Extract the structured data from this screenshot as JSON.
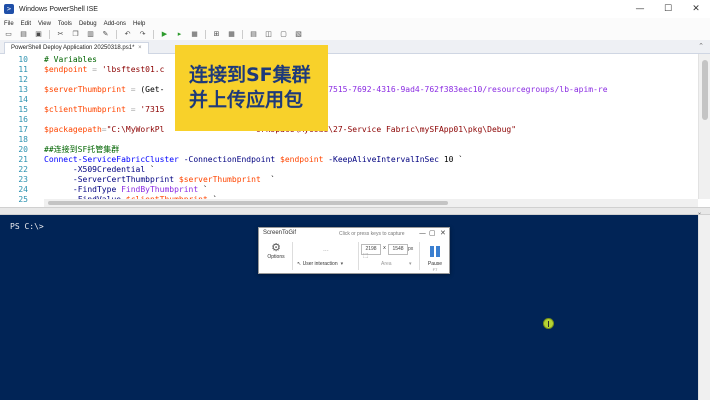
{
  "window": {
    "title": "Windows PowerShell ISE",
    "app_icon": "powershell-icon",
    "controls": [
      "—",
      "☐",
      "✕"
    ]
  },
  "menu": [
    "File",
    "Edit",
    "View",
    "Tools",
    "Debug",
    "Add-ons",
    "Help"
  ],
  "toolbar": {
    "icons": [
      "new-file-icon",
      "open-folder-icon",
      "save-icon",
      "cut-icon",
      "copy-icon",
      "paste-icon",
      "clear-icon",
      "undo-icon",
      "redo-icon",
      "run-icon",
      "run-selection-icon",
      "stop-icon",
      "new-remote-tab-icon",
      "start-powershell-icon",
      "show-script-pane-icon",
      "show-script-right-icon",
      "show-script-max-icon",
      "show-command-icon"
    ]
  },
  "tab": {
    "label": "PowerShell Deploy Application 20250318.ps1*",
    "close": "×"
  },
  "editor": {
    "lines": [
      {
        "num": "10",
        "tokens": [
          {
            "t": "# Variables",
            "c": "c-com"
          }
        ]
      },
      {
        "num": "11",
        "tokens": [
          {
            "t": "$endpoint",
            "c": "c-var"
          },
          {
            "t": " = ",
            "c": "c-op"
          },
          {
            "t": "'lbsftest01.c",
            "c": "c-str"
          },
          {
            "t": "                    ",
            "c": "c-pl"
          },
          {
            "t": "dapi.cn:19000'",
            "c": "c-str"
          }
        ]
      },
      {
        "num": "12",
        "tokens": []
      },
      {
        "num": "13",
        "tokens": [
          {
            "t": "$serverThumbprint",
            "c": "c-var"
          },
          {
            "t": " = ",
            "c": "c-op"
          },
          {
            "t": "(Get-",
            "c": "c-pl"
          },
          {
            "t": "                     ",
            "c": "c-pl"
          },
          {
            "t": "riptions/a9dc7515-7692-4316-9ad4-762f383eec10/resourcegroups/lb-apim-re",
            "c": "c-txt"
          }
        ]
      },
      {
        "num": "14",
        "tokens": []
      },
      {
        "num": "15",
        "tokens": [
          {
            "t": "$clientThumbprint",
            "c": "c-var"
          },
          {
            "t": " = ",
            "c": "c-op"
          },
          {
            "t": "'7315",
            "c": "c-str"
          },
          {
            "t": "                      ",
            "c": "c-pl"
          },
          {
            "t": "6105464'",
            "c": "c-str"
          }
        ]
      },
      {
        "num": "16",
        "tokens": []
      },
      {
        "num": "17",
        "tokens": [
          {
            "t": "$packagepath",
            "c": "c-var"
          },
          {
            "t": "=",
            "c": "c-op"
          },
          {
            "t": "\"C:\\MyWorkPl",
            "c": "c-str"
          },
          {
            "t": "                   ",
            "c": "c-pl"
          },
          {
            "t": "orkspace\\MyCode\\27-Service Fabric\\mySFApp01\\pkg\\Debug\"",
            "c": "c-str"
          }
        ]
      },
      {
        "num": "18",
        "tokens": []
      },
      {
        "num": "20",
        "tokens": [
          {
            "t": "##连接到SF托管集群",
            "c": "c-com"
          }
        ]
      },
      {
        "num": "21",
        "tokens": [
          {
            "t": "Connect-ServiceFabricCluster",
            "c": "c-cmd"
          },
          {
            "t": " ",
            "c": "c-pl"
          },
          {
            "t": "-ConnectionEndpoint",
            "c": "c-par"
          },
          {
            "t": " ",
            "c": "c-pl"
          },
          {
            "t": "$endpoint",
            "c": "c-var"
          },
          {
            "t": " ",
            "c": "c-pl"
          },
          {
            "t": "-KeepAliveIntervalInSec",
            "c": "c-par"
          },
          {
            "t": " 10 `",
            "c": "c-pl"
          }
        ]
      },
      {
        "num": "22",
        "tokens": [
          {
            "t": "      ",
            "c": "c-pl"
          },
          {
            "t": "-X509Credential",
            "c": "c-par"
          },
          {
            "t": " `",
            "c": "c-pl"
          }
        ]
      },
      {
        "num": "23",
        "tokens": [
          {
            "t": "      ",
            "c": "c-pl"
          },
          {
            "t": "-ServerCertThumbprint",
            "c": "c-par"
          },
          {
            "t": " ",
            "c": "c-pl"
          },
          {
            "t": "$serverThumbprint",
            "c": "c-var"
          },
          {
            "t": "  `",
            "c": "c-pl"
          }
        ]
      },
      {
        "num": "24",
        "tokens": [
          {
            "t": "      ",
            "c": "c-pl"
          },
          {
            "t": "-FindType",
            "c": "c-par"
          },
          {
            "t": " ",
            "c": "c-pl"
          },
          {
            "t": "FindByThumbprint",
            "c": "c-txt"
          },
          {
            "t": " `",
            "c": "c-pl"
          }
        ]
      },
      {
        "num": "25",
        "tokens": [
          {
            "t": "      ",
            "c": "c-pl"
          },
          {
            "t": "-FindValue",
            "c": "c-par"
          },
          {
            "t": " ",
            "c": "c-pl"
          },
          {
            "t": "$clientThumbprint",
            "c": "c-var"
          },
          {
            "t": " `",
            "c": "c-pl"
          }
        ]
      }
    ]
  },
  "console": {
    "prompt": "PS C:\\>"
  },
  "overlay": {
    "line1": "连接到SF集群",
    "line2": "并上传应用包"
  },
  "screentogif": {
    "name": "ScreenToGif",
    "hint": "Click or press keys to capture",
    "options_label": "Options",
    "mode_label": "User interaction",
    "width": "2198",
    "height": "1548",
    "x_sep": "x",
    "unit": "px",
    "area_label": "Area",
    "pause_label": "Pause",
    "pause_key": "F7",
    "dots": "..."
  },
  "colors": {
    "console_bg": "#012456",
    "overlay_bg": "#f8d12a",
    "overlay_text": "#1e3a7a"
  }
}
